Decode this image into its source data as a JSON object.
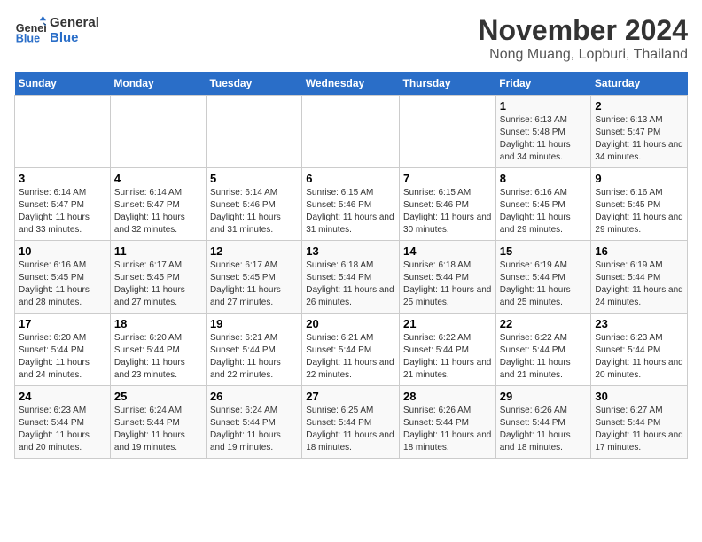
{
  "logo": {
    "line1": "General",
    "line2": "Blue"
  },
  "title": "November 2024",
  "subtitle": "Nong Muang, Lopburi, Thailand",
  "days_of_week": [
    "Sunday",
    "Monday",
    "Tuesday",
    "Wednesday",
    "Thursday",
    "Friday",
    "Saturday"
  ],
  "weeks": [
    [
      {
        "day": null
      },
      {
        "day": null
      },
      {
        "day": null
      },
      {
        "day": null
      },
      {
        "day": null
      },
      {
        "day": "1",
        "sunrise": "6:13 AM",
        "sunset": "5:48 PM",
        "daylight": "11 hours and 34 minutes."
      },
      {
        "day": "2",
        "sunrise": "6:13 AM",
        "sunset": "5:47 PM",
        "daylight": "11 hours and 34 minutes."
      }
    ],
    [
      {
        "day": "3",
        "sunrise": "6:14 AM",
        "sunset": "5:47 PM",
        "daylight": "11 hours and 33 minutes."
      },
      {
        "day": "4",
        "sunrise": "6:14 AM",
        "sunset": "5:47 PM",
        "daylight": "11 hours and 32 minutes."
      },
      {
        "day": "5",
        "sunrise": "6:14 AM",
        "sunset": "5:46 PM",
        "daylight": "11 hours and 31 minutes."
      },
      {
        "day": "6",
        "sunrise": "6:15 AM",
        "sunset": "5:46 PM",
        "daylight": "11 hours and 31 minutes."
      },
      {
        "day": "7",
        "sunrise": "6:15 AM",
        "sunset": "5:46 PM",
        "daylight": "11 hours and 30 minutes."
      },
      {
        "day": "8",
        "sunrise": "6:16 AM",
        "sunset": "5:45 PM",
        "daylight": "11 hours and 29 minutes."
      },
      {
        "day": "9",
        "sunrise": "6:16 AM",
        "sunset": "5:45 PM",
        "daylight": "11 hours and 29 minutes."
      }
    ],
    [
      {
        "day": "10",
        "sunrise": "6:16 AM",
        "sunset": "5:45 PM",
        "daylight": "11 hours and 28 minutes."
      },
      {
        "day": "11",
        "sunrise": "6:17 AM",
        "sunset": "5:45 PM",
        "daylight": "11 hours and 27 minutes."
      },
      {
        "day": "12",
        "sunrise": "6:17 AM",
        "sunset": "5:45 PM",
        "daylight": "11 hours and 27 minutes."
      },
      {
        "day": "13",
        "sunrise": "6:18 AM",
        "sunset": "5:44 PM",
        "daylight": "11 hours and 26 minutes."
      },
      {
        "day": "14",
        "sunrise": "6:18 AM",
        "sunset": "5:44 PM",
        "daylight": "11 hours and 25 minutes."
      },
      {
        "day": "15",
        "sunrise": "6:19 AM",
        "sunset": "5:44 PM",
        "daylight": "11 hours and 25 minutes."
      },
      {
        "day": "16",
        "sunrise": "6:19 AM",
        "sunset": "5:44 PM",
        "daylight": "11 hours and 24 minutes."
      }
    ],
    [
      {
        "day": "17",
        "sunrise": "6:20 AM",
        "sunset": "5:44 PM",
        "daylight": "11 hours and 24 minutes."
      },
      {
        "day": "18",
        "sunrise": "6:20 AM",
        "sunset": "5:44 PM",
        "daylight": "11 hours and 23 minutes."
      },
      {
        "day": "19",
        "sunrise": "6:21 AM",
        "sunset": "5:44 PM",
        "daylight": "11 hours and 22 minutes."
      },
      {
        "day": "20",
        "sunrise": "6:21 AM",
        "sunset": "5:44 PM",
        "daylight": "11 hours and 22 minutes."
      },
      {
        "day": "21",
        "sunrise": "6:22 AM",
        "sunset": "5:44 PM",
        "daylight": "11 hours and 21 minutes."
      },
      {
        "day": "22",
        "sunrise": "6:22 AM",
        "sunset": "5:44 PM",
        "daylight": "11 hours and 21 minutes."
      },
      {
        "day": "23",
        "sunrise": "6:23 AM",
        "sunset": "5:44 PM",
        "daylight": "11 hours and 20 minutes."
      }
    ],
    [
      {
        "day": "24",
        "sunrise": "6:23 AM",
        "sunset": "5:44 PM",
        "daylight": "11 hours and 20 minutes."
      },
      {
        "day": "25",
        "sunrise": "6:24 AM",
        "sunset": "5:44 PM",
        "daylight": "11 hours and 19 minutes."
      },
      {
        "day": "26",
        "sunrise": "6:24 AM",
        "sunset": "5:44 PM",
        "daylight": "11 hours and 19 minutes."
      },
      {
        "day": "27",
        "sunrise": "6:25 AM",
        "sunset": "5:44 PM",
        "daylight": "11 hours and 18 minutes."
      },
      {
        "day": "28",
        "sunrise": "6:26 AM",
        "sunset": "5:44 PM",
        "daylight": "11 hours and 18 minutes."
      },
      {
        "day": "29",
        "sunrise": "6:26 AM",
        "sunset": "5:44 PM",
        "daylight": "11 hours and 18 minutes."
      },
      {
        "day": "30",
        "sunrise": "6:27 AM",
        "sunset": "5:44 PM",
        "daylight": "11 hours and 17 minutes."
      }
    ]
  ],
  "labels": {
    "sunrise": "Sunrise:",
    "sunset": "Sunset:",
    "daylight": "Daylight:"
  }
}
